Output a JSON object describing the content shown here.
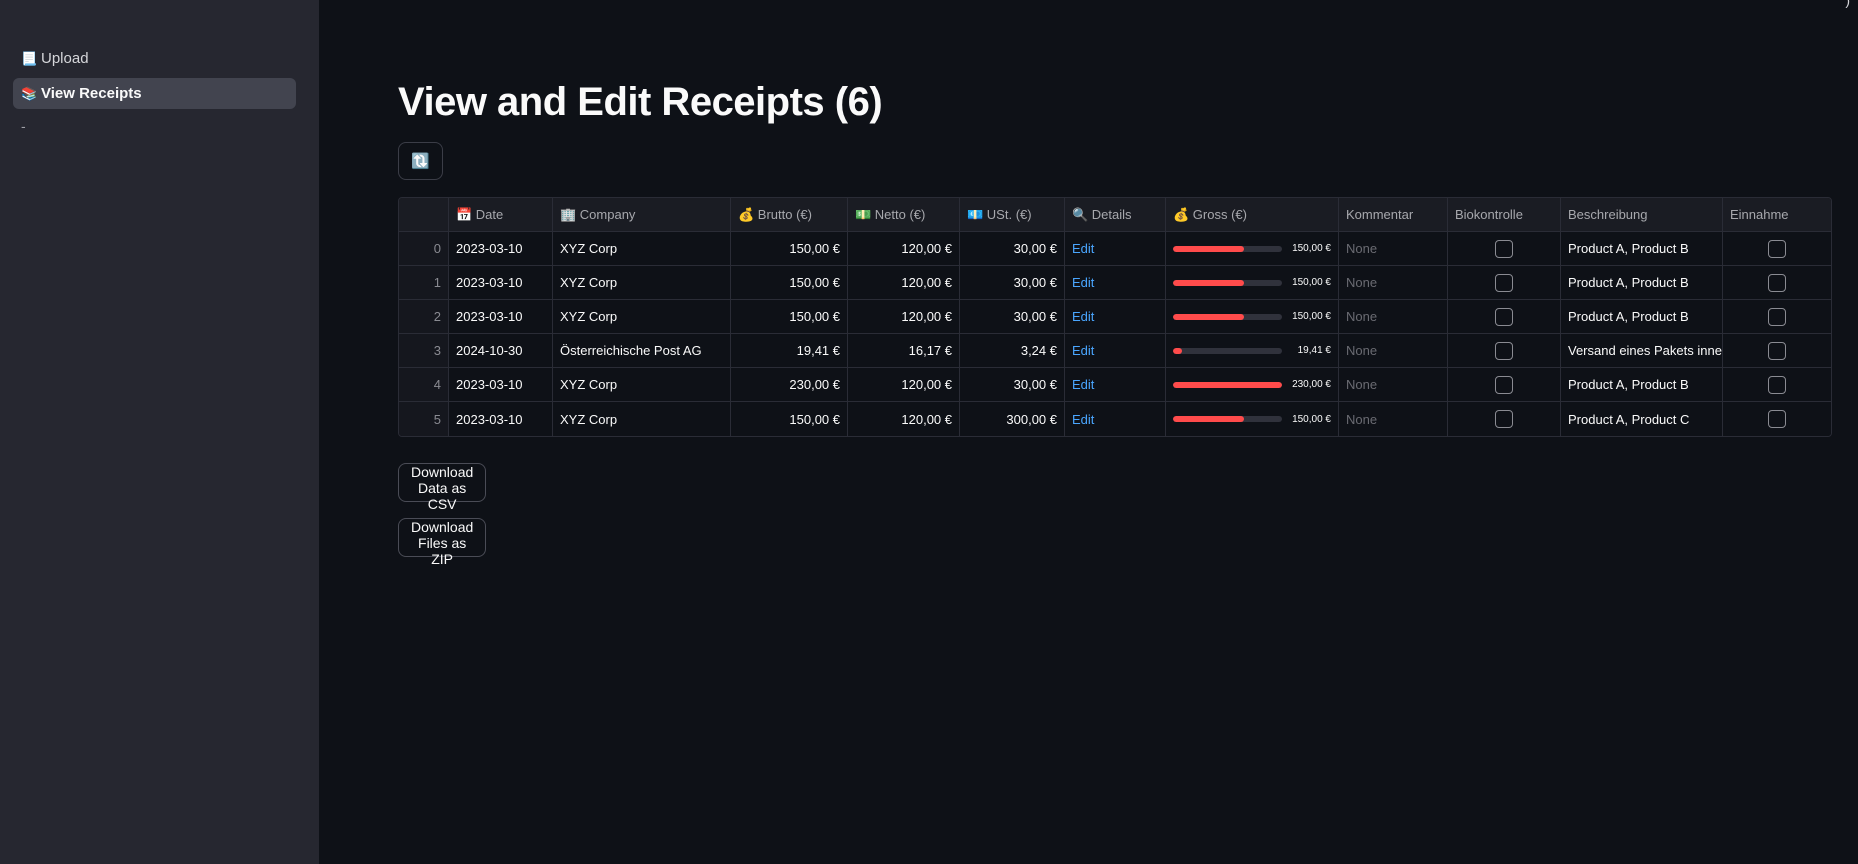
{
  "sidebar": {
    "items": [
      {
        "icon": "📃",
        "label": "Upload",
        "active": false
      },
      {
        "icon": "📚",
        "label": "View Receipts",
        "active": true
      }
    ],
    "separator": "-"
  },
  "corner_text": "ʼ)",
  "main": {
    "title": "View and Edit Receipts (6)",
    "refresh_icon": "🔃",
    "table": {
      "columns": [
        "",
        "📅 Date",
        "🏢 Company",
        "💰 Brutto (€)",
        "💵 Netto (€)",
        "💶 USt. (€)",
        "🔍 Details",
        "💰 Gross (€)",
        "Kommentar",
        "Biokontrolle",
        "Beschreibung",
        "Einnahme"
      ],
      "gross_max": 230,
      "rows": [
        {
          "idx": "0",
          "date": "2023-03-10",
          "company": "XYZ Corp",
          "brutto": "150,00 €",
          "netto": "120,00 €",
          "ust": "30,00 €",
          "details": "Edit",
          "gross": 150,
          "gross_label": "150,00 €",
          "kommentar": "None",
          "beschreibung": "Product A, Product B"
        },
        {
          "idx": "1",
          "date": "2023-03-10",
          "company": "XYZ Corp",
          "brutto": "150,00 €",
          "netto": "120,00 €",
          "ust": "30,00 €",
          "details": "Edit",
          "gross": 150,
          "gross_label": "150,00 €",
          "kommentar": "None",
          "beschreibung": "Product A, Product B"
        },
        {
          "idx": "2",
          "date": "2023-03-10",
          "company": "XYZ Corp",
          "brutto": "150,00 €",
          "netto": "120,00 €",
          "ust": "30,00 €",
          "details": "Edit",
          "gross": 150,
          "gross_label": "150,00 €",
          "kommentar": "None",
          "beschreibung": "Product A, Product B"
        },
        {
          "idx": "3",
          "date": "2024-10-30",
          "company": "Österreichische Post AG",
          "brutto": "19,41 €",
          "netto": "16,17 €",
          "ust": "3,24 €",
          "details": "Edit",
          "gross": 19.41,
          "gross_label": "19,41 €",
          "kommentar": "None",
          "beschreibung": "Versand eines Pakets inner"
        },
        {
          "idx": "4",
          "date": "2023-03-10",
          "company": "XYZ Corp",
          "brutto": "230,00 €",
          "netto": "120,00 €",
          "ust": "30,00 €",
          "details": "Edit",
          "gross": 230,
          "gross_label": "230,00 €",
          "kommentar": "None",
          "beschreibung": "Product A, Product B"
        },
        {
          "idx": "5",
          "date": "2023-03-10",
          "company": "XYZ Corp",
          "brutto": "150,00 €",
          "netto": "120,00 €",
          "ust": "300,00 €",
          "details": "Edit",
          "gross": 150,
          "gross_label": "150,00 €",
          "kommentar": "None",
          "beschreibung": "Product A, Product C"
        }
      ]
    },
    "download_csv_label": "Download Data as CSV",
    "download_zip_label": "Download Files as ZIP"
  },
  "colors": {
    "background": "#0e1117",
    "sidebar": "#262730",
    "accent": "#ff4b4b",
    "link": "#4aa6ff"
  }
}
